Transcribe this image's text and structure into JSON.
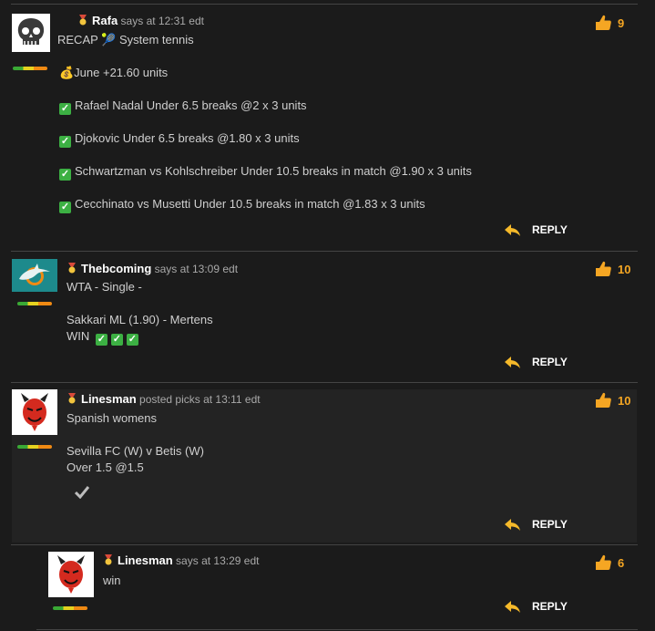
{
  "comments": [
    {
      "user": "Rafa",
      "says": "says",
      "time": "at 12:31 edt",
      "likes": "9",
      "lines": [
        "RECAP 🎾 System tennis",
        "💰June +21.60 units",
        "Rafael Nadal Under 6.5 breaks @2 x 3 units",
        "Djokovic Under 6.5 breaks @1.80 x 3 units",
        "Schwartzman vs Kohlschreiber Under 10.5 breaks in match @1.90 x 3 units",
        "Cecchinato vs Musetti Under 10.5 breaks in match @1.83 x 3 units"
      ],
      "reply": "REPLY"
    },
    {
      "user": "Thebcoming",
      "says": "says",
      "time": "at 13:09 edt",
      "likes": "10",
      "lines": [
        "WTA - Single -",
        "Sakkari ML (1.90) - Mertens",
        "WIN"
      ],
      "reply": "REPLY"
    },
    {
      "user": "Linesman",
      "says": "posted picks",
      "time": "at 13:11 edt",
      "likes": "10",
      "lines": [
        "Spanish womens",
        "Sevilla FC (W) v Betis (W)",
        "Over 1.5 @1.5"
      ],
      "reply": "REPLY"
    },
    {
      "user": "Linesman",
      "says": "says",
      "time": "at 13:29 edt",
      "likes": "6",
      "lines": [
        "win"
      ],
      "reply": "REPLY"
    }
  ],
  "colors": {
    "accent": "#f5a623",
    "background": "#1b1b1b",
    "check": "#3cb043"
  },
  "icons": {
    "like": "thumbs-up-icon",
    "reply": "reply-arrow-icon",
    "medal": "medal-icon",
    "check": "check-icon"
  }
}
